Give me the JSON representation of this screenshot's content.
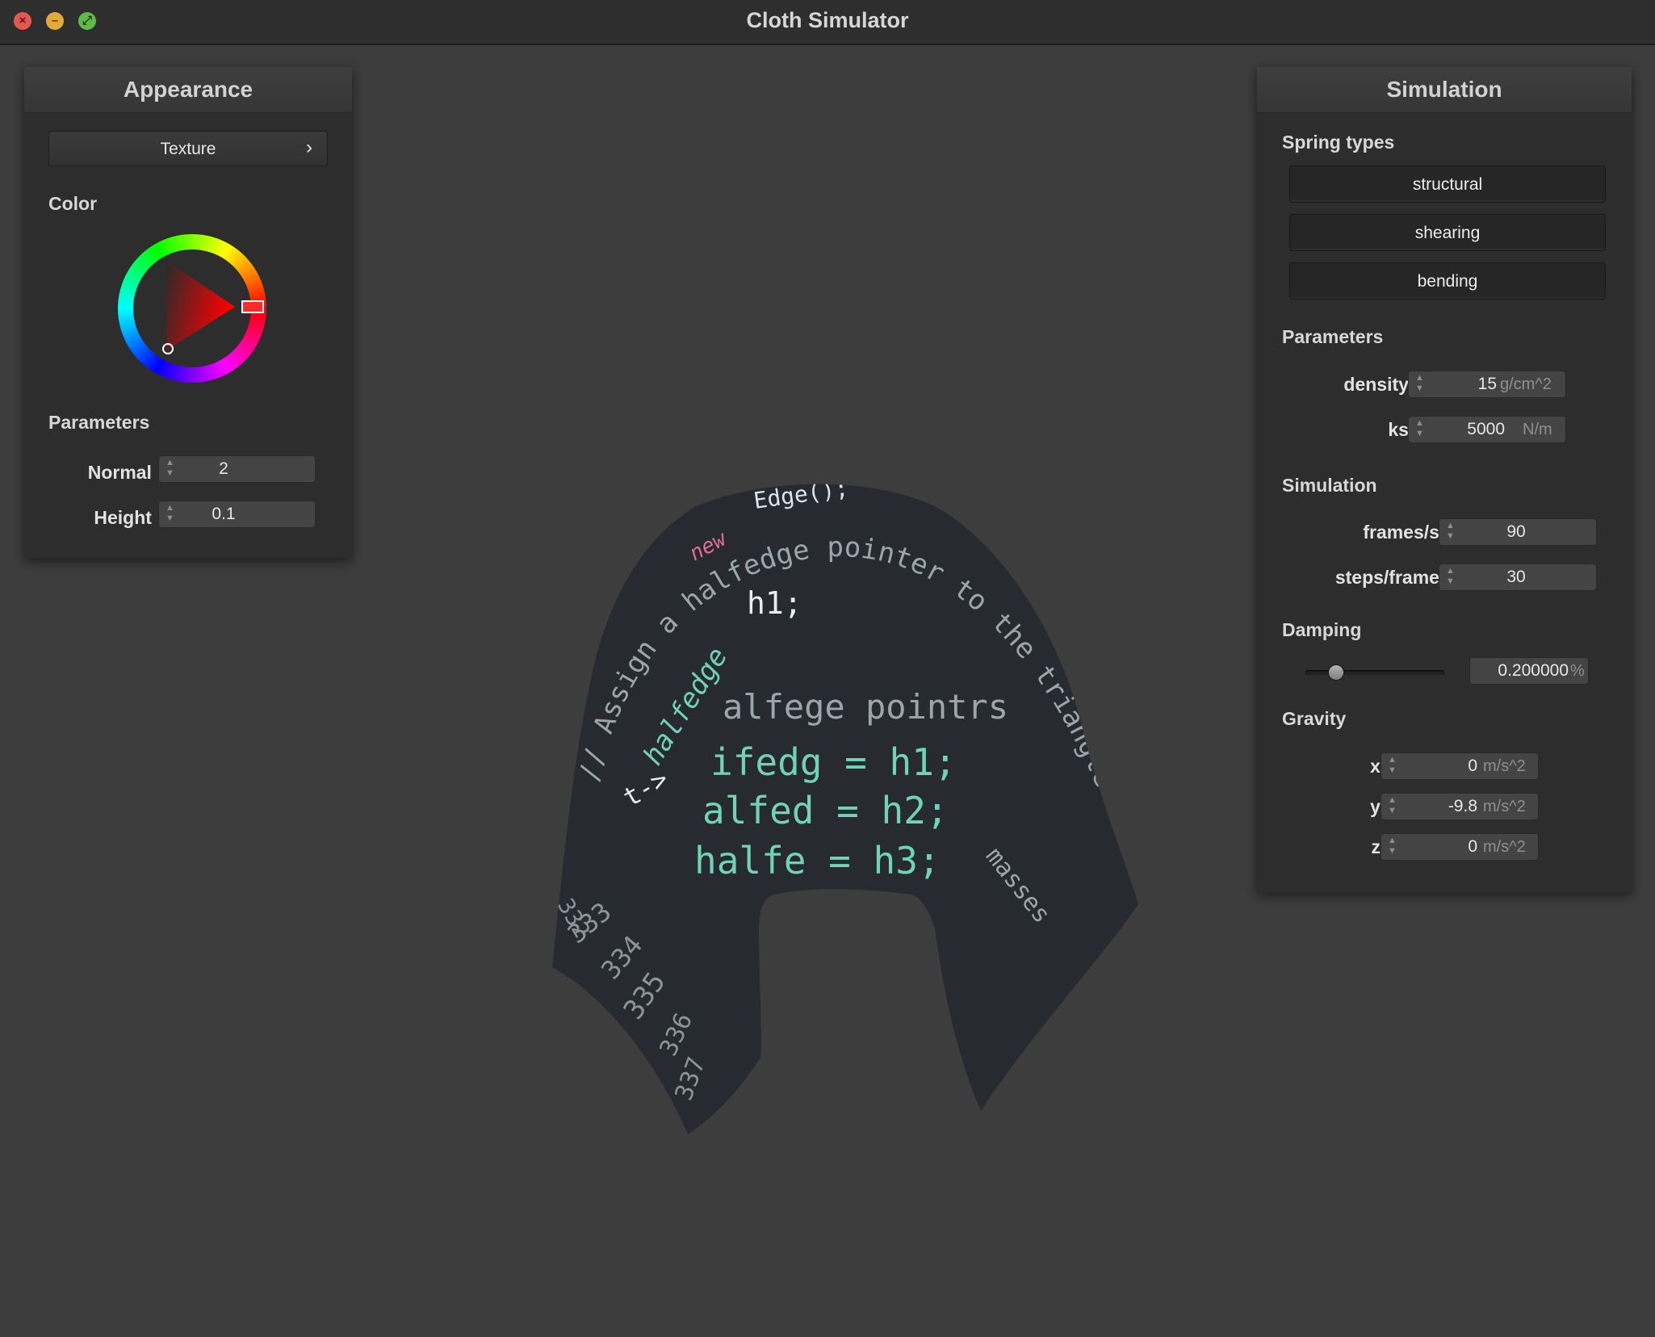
{
  "window": {
    "title": "Cloth Simulator"
  },
  "appearance": {
    "header": "Appearance",
    "texture_button": "Texture",
    "chevron": "›",
    "color_section": "Color",
    "color_wheel_hue": "#ff0000",
    "parameters_section": "Parameters",
    "normal": {
      "label": "Normal :",
      "value": "2"
    },
    "height": {
      "label": "Height :",
      "value": "0.1"
    }
  },
  "simulation_panel": {
    "header": "Simulation",
    "spring_types_section": "Spring types",
    "spring_buttons": [
      "structural",
      "shearing",
      "bending"
    ],
    "parameters_section": "Parameters",
    "density": {
      "label": "density :",
      "value": "15",
      "unit": "g/cm^2"
    },
    "ks": {
      "label": "ks :",
      "value": "5000",
      "unit": "N/m"
    },
    "simulation_section": "Simulation",
    "fps": {
      "label": "frames/s :",
      "value": "90"
    },
    "steps": {
      "label": "steps/frame :",
      "value": "30"
    },
    "damping_section": "Damping",
    "damping": {
      "value": "0.200000",
      "unit": "%",
      "slider_fraction": 0.2
    },
    "gravity_section": "Gravity",
    "gx": {
      "label": "x :",
      "value": "0",
      "unit": "m/s^2"
    },
    "gy": {
      "label": "y :",
      "value": "-9.8",
      "unit": "m/s^2"
    },
    "gz": {
      "label": "z :",
      "value": "0",
      "unit": "m/s^2"
    }
  },
  "cloth_texture": {
    "code_lines": [
      "Edge();",
      "new",
      "// Assign a halfedge pointer to the triangle",
      "halfedge",
      "h1;",
      "alfege pointrs",
      "ifedg = h1;",
      "alfed = h2;",
      "halfe = h3;",
      "t->",
      "masses"
    ],
    "line_numbers": [
      "332",
      "333",
      "334",
      "335",
      "336",
      "337"
    ]
  },
  "colors": {
    "background": "#3d3d3d",
    "panel": "#2d2d2d",
    "cloth": "#272a30",
    "code_teal": "#6fd3b4",
    "code_pink": "#e06c9c"
  }
}
